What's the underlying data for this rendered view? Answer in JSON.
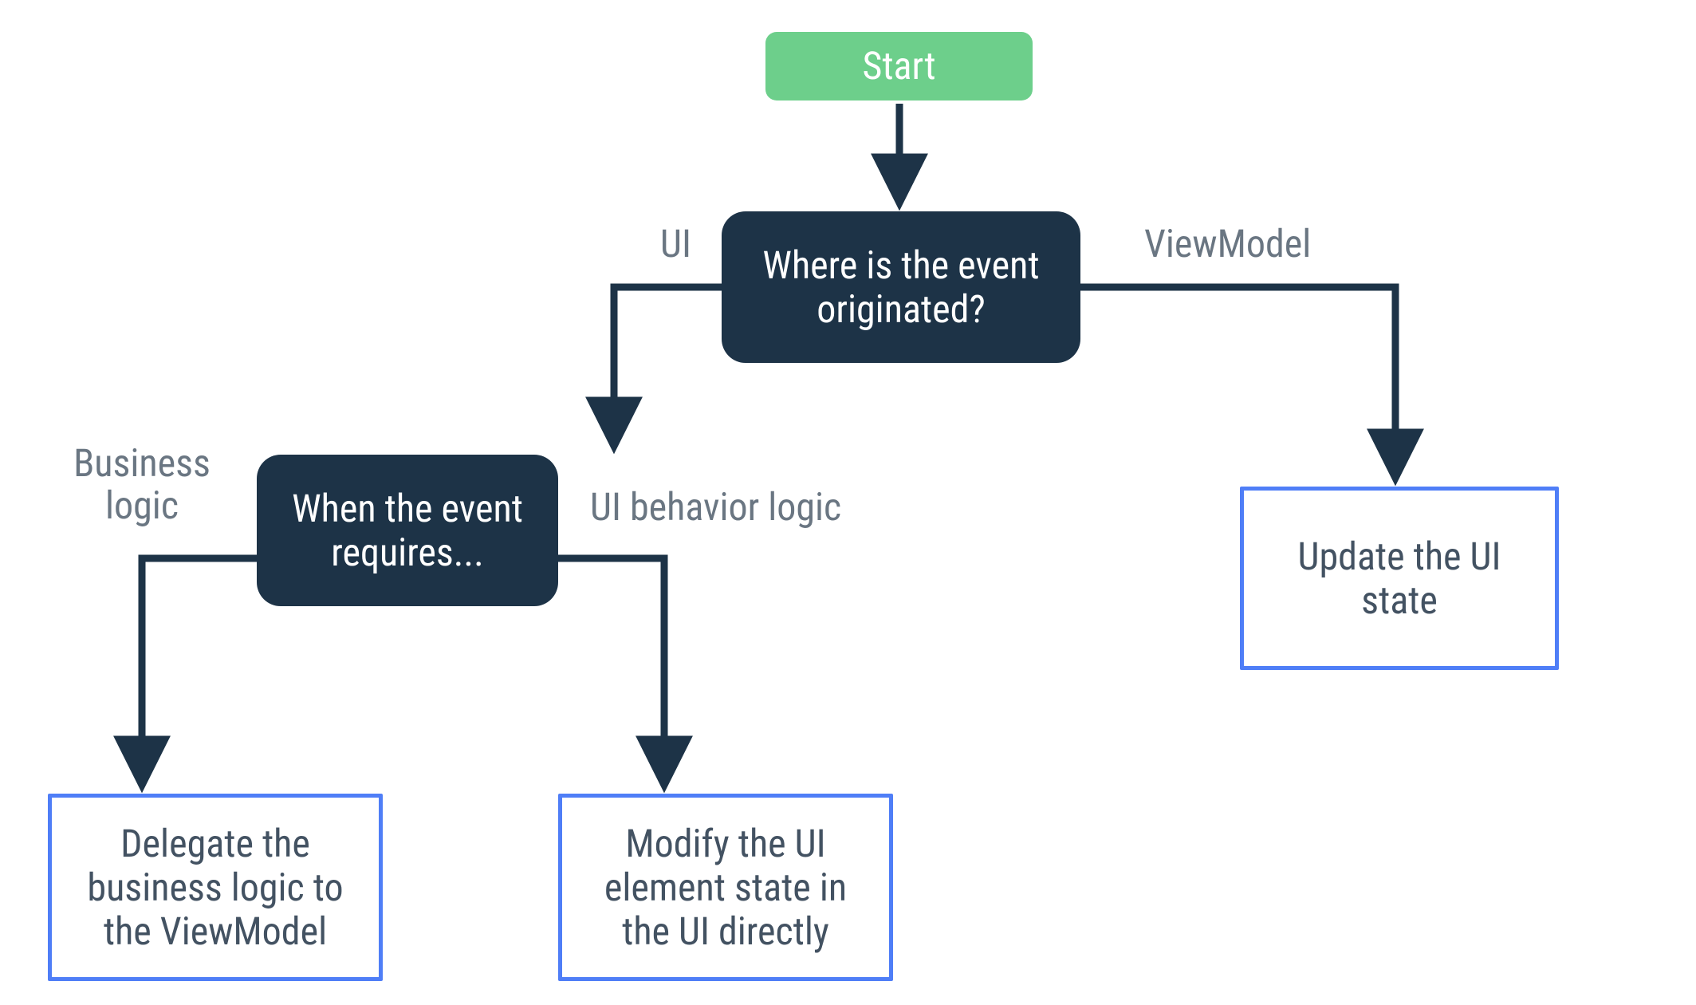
{
  "nodes": {
    "start": "Start",
    "decision1": "Where is the event originated?",
    "decision2": "When the event requires...",
    "terminal_update": "Update the UI state",
    "terminal_delegate": "Delegate the business logic to the ViewModel",
    "terminal_modify": "Modify the UI element state in the UI directly"
  },
  "edges": {
    "ui": "UI",
    "viewmodel": "ViewModel",
    "business_logic": "Business logic",
    "ui_behavior_logic": "UI behavior logic"
  },
  "colors": {
    "start_bg": "#6dcf8b",
    "decision_bg": "#1d3347",
    "terminal_border": "#4f7ef7",
    "edge_text": "#6a7682",
    "arrow": "#1d3347"
  }
}
